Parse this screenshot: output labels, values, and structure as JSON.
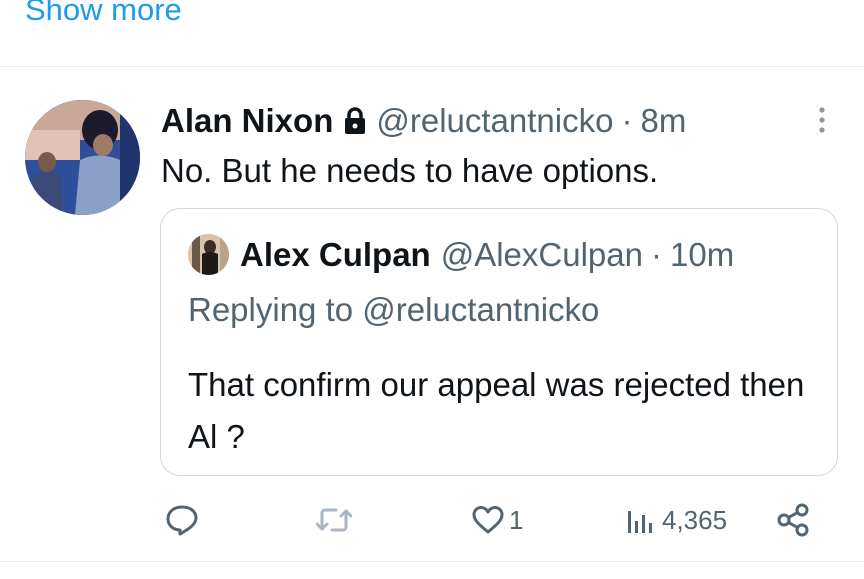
{
  "show_more": "Show more",
  "tweet": {
    "name": "Alan Nixon",
    "handle": "@reluctantnicko",
    "separator": "·",
    "time": "8m",
    "text": "No. But he needs to have options.",
    "icons": {
      "lock": "lock-icon",
      "more": "more-vertical-icon"
    }
  },
  "quote": {
    "name": "Alex Culpan",
    "handle": "@AlexCulpan",
    "separator": "·",
    "time": "10m",
    "replying_to": "Replying to @reluctantnicko",
    "text": "That confirm our appeal was rejected then Al ?"
  },
  "actions": {
    "reply": {
      "icon": "reply-icon",
      "count": ""
    },
    "retweet": {
      "icon": "retweet-icon",
      "count": ""
    },
    "like": {
      "icon": "heart-icon",
      "count": "1"
    },
    "views": {
      "icon": "views-icon",
      "count": "4,365"
    },
    "share": {
      "icon": "share-icon"
    }
  },
  "colors": {
    "accent": "#1d9bf0",
    "text_primary": "#0f1419",
    "text_secondary": "#536471",
    "border": "#cfd9de",
    "icon_gray": "#536471",
    "retweet_icon": "#a9b6c2"
  }
}
